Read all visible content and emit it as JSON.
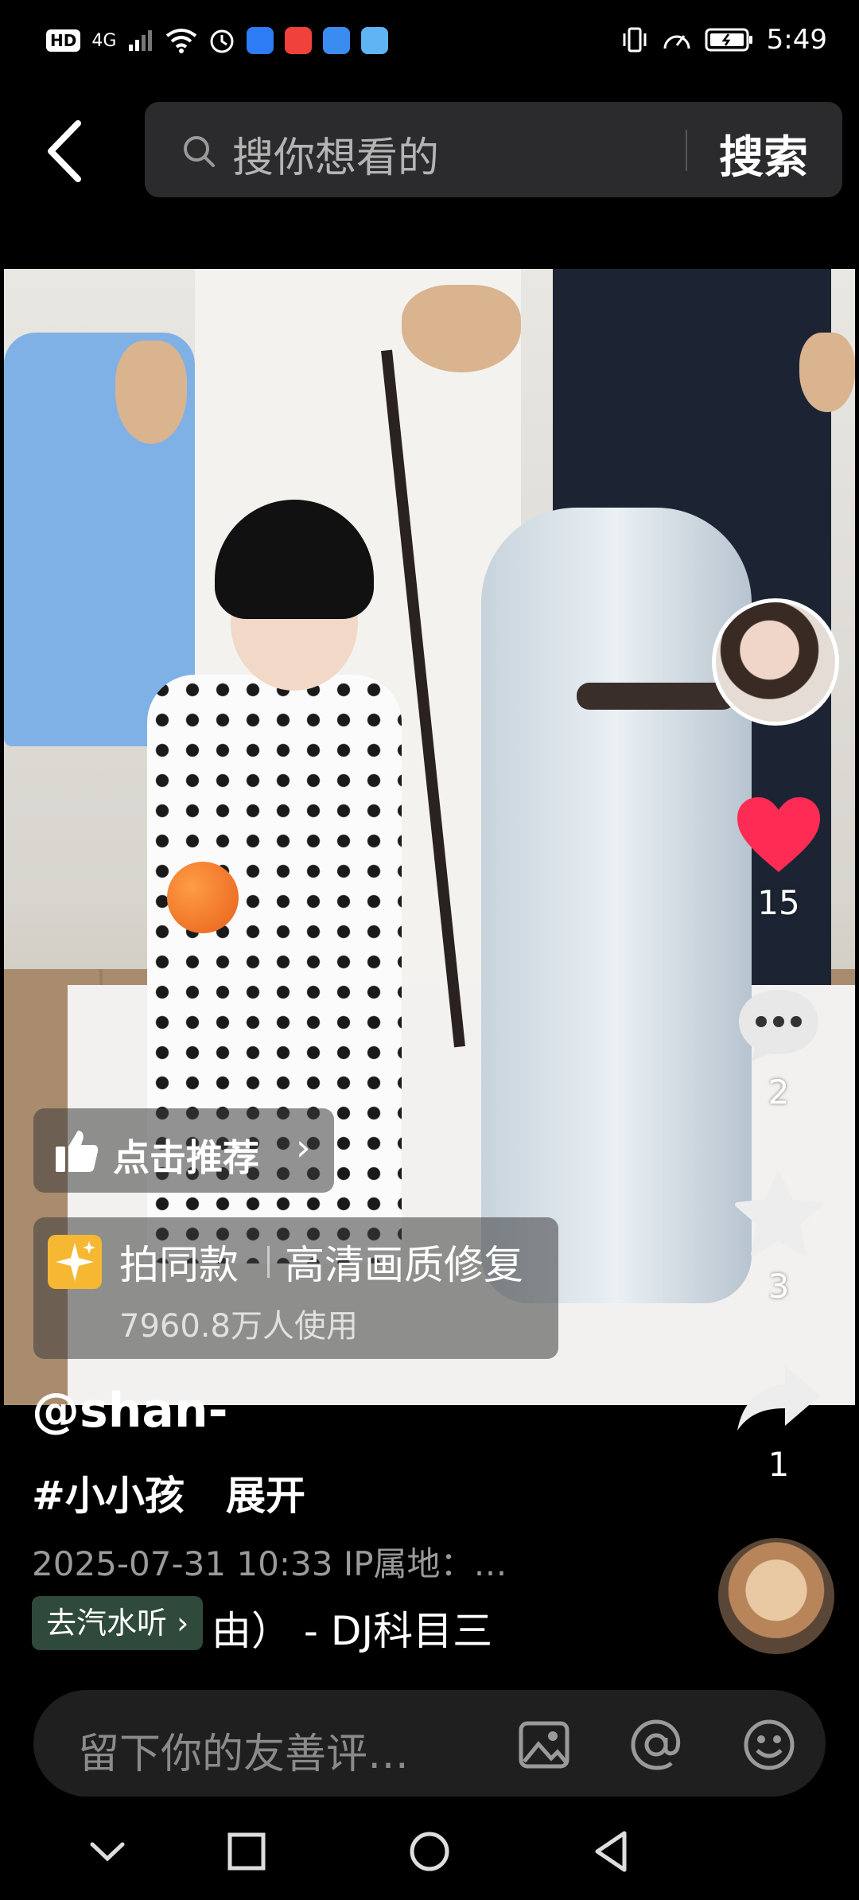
{
  "status_bar": {
    "network_badge": "HD",
    "signal": "4G",
    "time": "5:49",
    "icons": [
      "signal-icon",
      "wifi-icon",
      "alarm-icon",
      "vpn-shield-icon",
      "app-icon",
      "app-icon",
      "app-icon",
      "vibrate-icon",
      "speed-icon",
      "battery-icon"
    ]
  },
  "header": {
    "search_placeholder": "搜你想看的",
    "search_button": "搜索"
  },
  "overlay": {
    "recommend_label": "点击推荐",
    "effect_title": "拍同款",
    "effect_name": "高清画质修复",
    "effect_users": "7960.8万人使用"
  },
  "actions": {
    "like_count": "15",
    "comment_count": "2",
    "favorite_count": "3",
    "share_count": "1"
  },
  "post": {
    "author": "@shan-",
    "hashtag": "#小小孩",
    "expand": "展开",
    "meta": "2025-07-31 10:33  IP属地：…",
    "soda_button": "去汽水听 ›",
    "music": "由）  - DJ科目三"
  },
  "comment": {
    "placeholder": "留下你的友善评…"
  },
  "colors": {
    "like": "#fe2c55",
    "background": "#000000",
    "search_bg": "#2b2b2d"
  }
}
